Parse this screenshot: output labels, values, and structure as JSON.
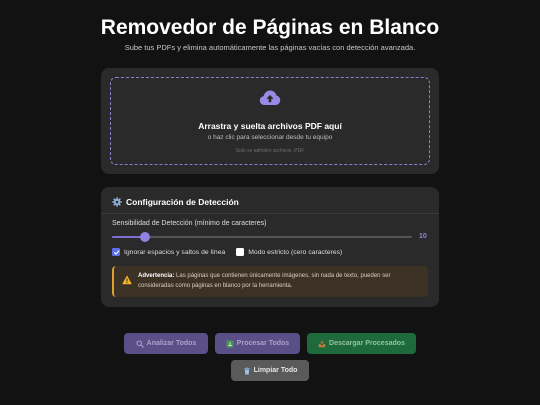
{
  "header": {
    "title": "Removedor de Páginas en Blanco",
    "subtitle": "Sube tus PDFs y elimina automáticamente las páginas vacías con detección avanzada."
  },
  "upload": {
    "icon": "cloud-upload-icon",
    "title": "Arrastra y suelta archivos PDF aquí",
    "subtitle": "o haz clic para seleccionar desde tu equipo",
    "note": "Solo se admiten archivos .PDF"
  },
  "config": {
    "title": "Configuración de Detección",
    "icon": "gear-icon",
    "sensitivity_label": "Sensibilidad de Detección (mínimo de caracteres)",
    "sensitivity_value": "10",
    "sensitivity_fraction": 0.11,
    "ignore_spaces_label": "Ignorar espacios y saltos de línea",
    "ignore_spaces_checked": true,
    "strict_mode_label": "Modo estricto (cero caracteres)",
    "strict_mode_checked": false
  },
  "warning": {
    "label": "Advertencia:",
    "text": " Las páginas que contienen únicamente imágenes, sin nada de texto, pueden ser consideradas como páginas en blanco por la herramienta."
  },
  "actions": {
    "analyze": "Analizar Todos",
    "process": "Procesar Todos",
    "download": "Descargar Procesados",
    "clear": "Limpiar Todo"
  },
  "colors": {
    "accent": "#8f82e0",
    "warning": "#e0a030",
    "success": "#1f6a3c",
    "background": "#121212",
    "card": "#2a2a2a"
  }
}
